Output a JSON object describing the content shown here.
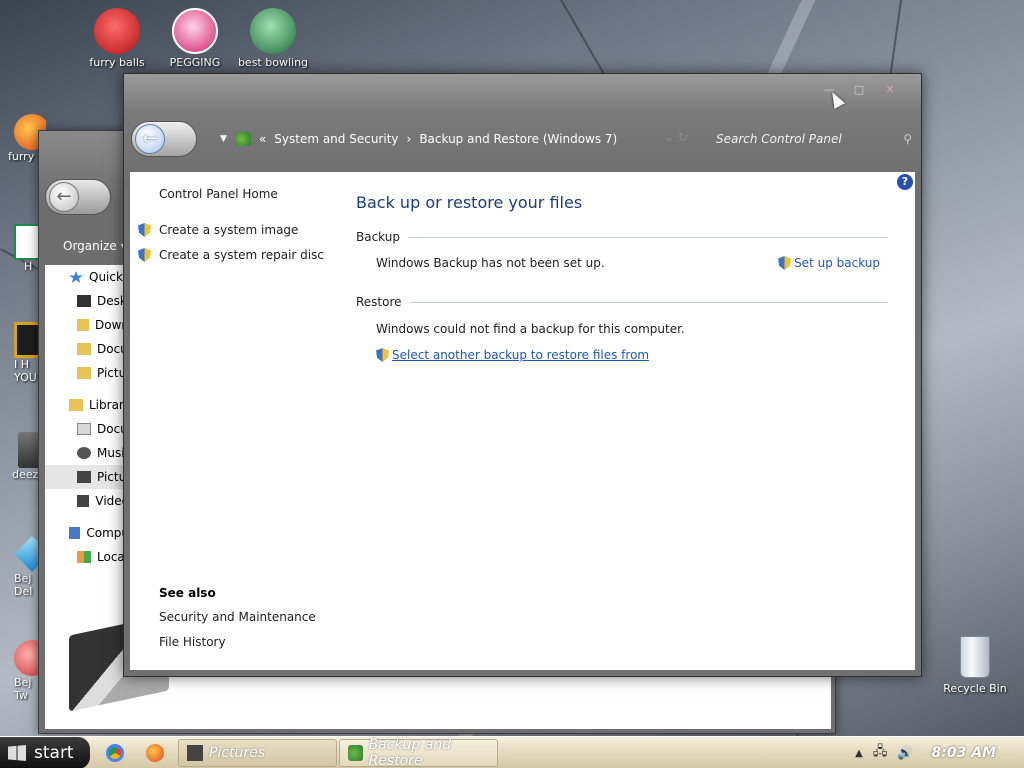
{
  "desktop": {
    "top_icons": [
      {
        "label": "furry balls",
        "color": "#d62020"
      },
      {
        "label": "PEGGING",
        "color": "#e0246e"
      },
      {
        "label": "best bowling",
        "color": "#2e8f4a"
      }
    ],
    "side_icons": [
      {
        "label": "furry",
        "color": "#e56b1f"
      },
      {
        "label": "H",
        "color": "#1e8a4c"
      },
      {
        "label": "I H YOU",
        "color": "#d9a21b"
      },
      {
        "label": "deez",
        "color": "#555555"
      },
      {
        "label": "Bej Del",
        "color": "#2aa7e0"
      },
      {
        "label": "Bej Tw",
        "color": "#c8323a"
      }
    ],
    "recycle_bin": "Recycle Bin"
  },
  "explorer": {
    "organize": "Organize ▾",
    "nav_items": [
      {
        "label": "Quick",
        "icon": "star-icon"
      },
      {
        "label": "Desk",
        "icon": "desktop-icon"
      },
      {
        "label": "Down",
        "icon": "downloads-icon"
      },
      {
        "label": "Docu",
        "icon": "folder-icon"
      },
      {
        "label": "Pictu",
        "icon": "folder-icon"
      },
      {
        "label": "Librar",
        "icon": "library-icon"
      },
      {
        "label": "Docu",
        "icon": "documents-icon"
      },
      {
        "label": "Musi",
        "icon": "music-icon"
      },
      {
        "label": "Pictu",
        "icon": "pictures-icon"
      },
      {
        "label": "Video",
        "icon": "videos-icon"
      },
      {
        "label": "Compu",
        "icon": "computer-icon"
      },
      {
        "label": "Loca",
        "icon": "drive-icon"
      }
    ]
  },
  "control_panel": {
    "window_buttons": {
      "minimize": "—",
      "maximize": "□",
      "close": "✕"
    },
    "breadcrumb": {
      "separator_start": "«",
      "items": [
        "System and Security",
        "Backup and Restore (Windows 7)"
      ],
      "separator": "›"
    },
    "search_placeholder": "Search Control Panel",
    "help": "?",
    "left_pane": {
      "home": "Control Panel Home",
      "tasks": [
        "Create a system image",
        "Create a system repair disc"
      ],
      "see_also_heading": "See also",
      "see_also": [
        "Security and Maintenance",
        "File History"
      ]
    },
    "main": {
      "title": "Back up or restore your files",
      "backup_heading": "Backup",
      "backup_status": "Windows Backup has not been set up.",
      "setup_link": "Set up backup",
      "restore_heading": "Restore",
      "restore_status": "Windows could not find a backup for this computer.",
      "restore_link": "Select another backup to restore files from"
    }
  },
  "taskbar": {
    "start": "start",
    "tasks": [
      {
        "label": "Pictures"
      },
      {
        "label": "Backup and Restore"
      }
    ],
    "clock": "8:03 AM"
  }
}
